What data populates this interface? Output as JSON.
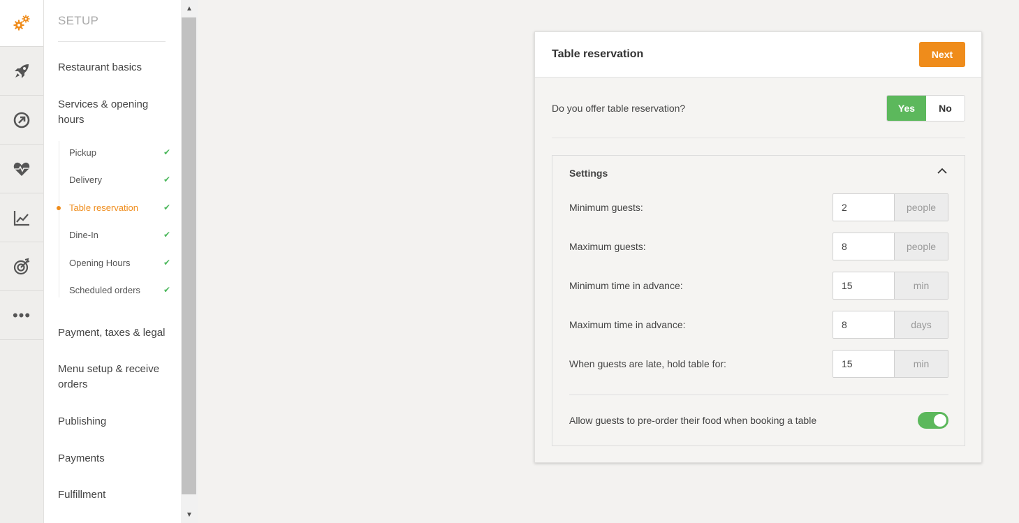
{
  "rail": {
    "items": [
      {
        "icon": "gears-icon",
        "active": true
      },
      {
        "icon": "rocket-icon"
      },
      {
        "icon": "arrow-circle-icon"
      },
      {
        "icon": "heart-pulse-icon"
      },
      {
        "icon": "chart-line-icon"
      },
      {
        "icon": "target-icon"
      },
      {
        "icon": "more-icon",
        "label": "•••"
      }
    ]
  },
  "sidebar": {
    "title": "SETUP",
    "items": [
      {
        "label": "Restaurant basics"
      },
      {
        "label": "Services & opening hours"
      },
      {
        "label": "Payment, taxes & legal"
      },
      {
        "label": "Menu setup & receive orders"
      },
      {
        "label": "Publishing"
      },
      {
        "label": "Payments"
      },
      {
        "label": "Fulfillment"
      }
    ],
    "subitems": [
      {
        "label": "Pickup",
        "check": "✔"
      },
      {
        "label": "Delivery",
        "check": "✔"
      },
      {
        "label": "Table reservation",
        "check": "✔",
        "active": true
      },
      {
        "label": "Dine-In",
        "check": "✔"
      },
      {
        "label": "Opening Hours",
        "check": "✔"
      },
      {
        "label": "Scheduled orders",
        "check": "✔"
      }
    ]
  },
  "scrollbar": {
    "up": "▲",
    "down": "▼"
  },
  "card": {
    "title": "Table reservation",
    "next_label": "Next",
    "question": "Do you offer table reservation?",
    "yes_label": "Yes",
    "no_label": "No",
    "selected": "Yes",
    "settings": {
      "title": "Settings",
      "fields": [
        {
          "label": "Minimum guests:",
          "value": "2",
          "unit": "people"
        },
        {
          "label": "Maximum guests:",
          "value": "8",
          "unit": "people"
        },
        {
          "label": "Minimum time in advance:",
          "value": "15",
          "unit": "min"
        },
        {
          "label": "Maximum time in advance:",
          "value": "8",
          "unit": "days"
        },
        {
          "label": "When guests are late, hold table for:",
          "value": "15",
          "unit": "min"
        }
      ],
      "preorder_label": "Allow guests to pre-order their food when booking a table",
      "preorder_enabled": true
    }
  },
  "colors": {
    "accent_orange": "#ef8c1b",
    "success_green": "#5cb85c",
    "check_green": "#4cb85c"
  }
}
